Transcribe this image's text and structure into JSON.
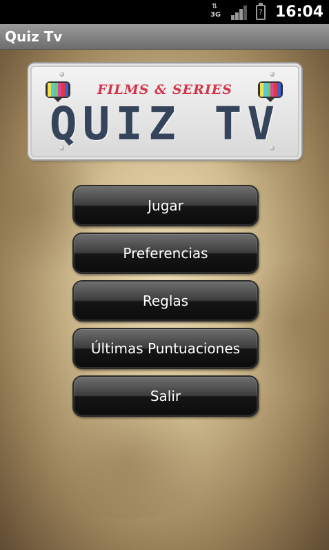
{
  "status_bar": {
    "network_type": "3G",
    "battery_glyph": "?",
    "time": "16:04"
  },
  "app": {
    "title": "Quiz Tv"
  },
  "logo": {
    "subtitle": "FILMS & SERIES",
    "title": "QUIZ TV",
    "colors": {
      "subtitle": "#d3364b",
      "title": "#35445a"
    }
  },
  "menu": {
    "items": [
      {
        "label": "Jugar"
      },
      {
        "label": "Preferencias"
      },
      {
        "label": "Reglas"
      },
      {
        "label": "Últimas Puntuaciones"
      },
      {
        "label": "Salir"
      }
    ]
  }
}
